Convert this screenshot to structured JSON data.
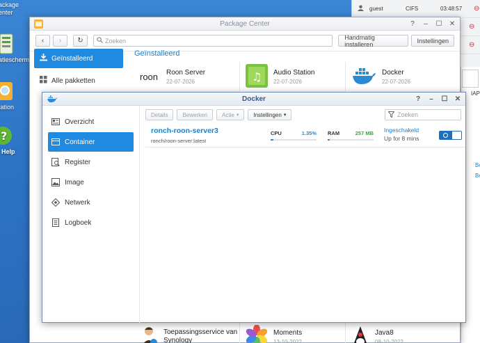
{
  "desktop": {
    "icons": [
      {
        "label": "ackage\nenter"
      },
      {
        "label": "atiescherm"
      },
      {
        "label": "tation"
      },
      {
        "label": "Help"
      }
    ]
  },
  "notifications": {
    "user": "guest",
    "protocol": "CIFS",
    "time": "03:48:57"
  },
  "side_peek": {
    "text1": "IAP",
    "text2": "Be",
    "text3": "Be"
  },
  "package_center": {
    "title": "Package Center",
    "search_placeholder": "Zoeken",
    "manual_install_label": "Handmatig installeren",
    "settings_label": "Instellingen",
    "nav": [
      {
        "label": "Geïnstalleerd"
      },
      {
        "label": "Alle pakketten"
      }
    ],
    "heading": "Geïnstalleerd",
    "packages_top": [
      {
        "name": "Roon Server",
        "date": "22-07-2026",
        "logo_text": "roon"
      },
      {
        "name": "Audio Station",
        "date": "22-07-2026"
      },
      {
        "name": "Docker",
        "date": "22-07-2026"
      }
    ],
    "packages_bottom": [
      {
        "name": "Toepassingsservice van Synology",
        "date": ""
      },
      {
        "name": "Moments",
        "date": "13-10-2022"
      },
      {
        "name": "Java8",
        "date": "08-10-2022"
      }
    ]
  },
  "docker": {
    "title": "Docker",
    "nav": [
      {
        "label": "Overzicht"
      },
      {
        "label": "Container"
      },
      {
        "label": "Register"
      },
      {
        "label": "Image"
      },
      {
        "label": "Netwerk"
      },
      {
        "label": "Logboek"
      }
    ],
    "toolbar": {
      "details": "Details",
      "edit": "Bewerken",
      "action": "Actie",
      "settings": "Instellingen",
      "search_placeholder": "Zoeken"
    },
    "containers": [
      {
        "name": "ronch-roon-server3",
        "image": "ronch/roon-server:latest",
        "cpu_label": "CPU",
        "cpu_value": "1.35%",
        "cpu_fraction": 0.0135,
        "ram_label": "RAM",
        "ram_value": "257 MB",
        "ram_fraction": 0.05,
        "status": "Ingeschakeld",
        "uptime": "Up for 8 mins",
        "enabled": true
      }
    ]
  },
  "colors": {
    "accent": "#1f8ae0",
    "cpu": "#1f8ae0",
    "ram": "#35a73c"
  }
}
